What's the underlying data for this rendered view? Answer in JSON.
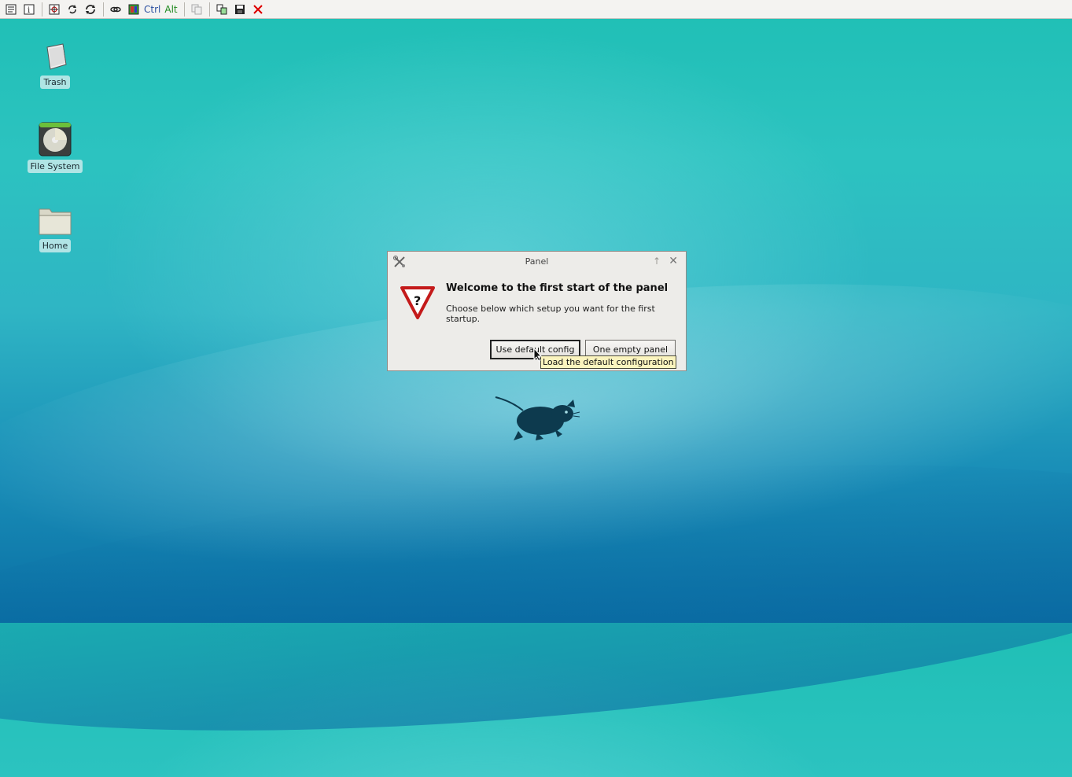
{
  "toolbar": {
    "buttons": [
      "properties-icon",
      "info-icon",
      "select-icon",
      "refresh-icon",
      "sync-icon",
      "link-icon",
      "panel-icon"
    ],
    "ctrl_label": "Ctrl",
    "alt_label": "Alt",
    "right_buttons": [
      "copy-icon",
      "transfer-icon",
      "save-icon",
      "close-icon"
    ]
  },
  "desktop": {
    "icons": [
      {
        "label": "Trash",
        "icon": "trash-icon"
      },
      {
        "label": "File System",
        "icon": "drive-icon"
      },
      {
        "label": "Home",
        "icon": "folder-icon"
      }
    ]
  },
  "dialog": {
    "title": "Panel",
    "heading": "Welcome to the first start of the panel",
    "message": "Choose below which setup you want for the first startup.",
    "primary_button": "Use default config",
    "secondary_button": "One empty panel",
    "tooltip": "Load the default configuration",
    "icon": "warning-question-icon"
  },
  "colors": {
    "desktop_top": "#1fbfb5",
    "desktop_bottom": "#0a6fa4",
    "dialog_bg": "#edece9",
    "tooltip_bg": "#fbf4be"
  }
}
